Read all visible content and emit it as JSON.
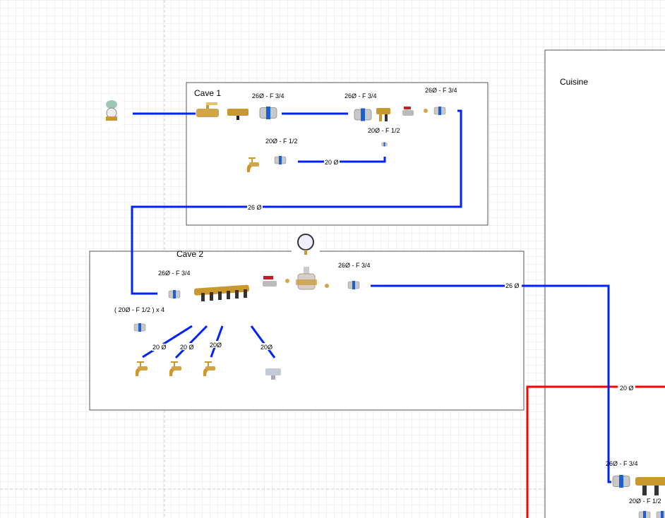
{
  "colors": {
    "cold_pipe": "#0022ff",
    "hot_pipe": "#ff0000",
    "brass": "#c9982f",
    "grid": "#e6e6e6"
  },
  "rooms": {
    "cave1": {
      "title": "Cave 1"
    },
    "cave2": {
      "title": "Cave 2"
    },
    "cuisine": {
      "title": "Cuisine"
    }
  },
  "labels": {
    "c1_a": "26Ø - F 3/4",
    "c1_b": "26Ø - F 3/4",
    "c1_c": "26Ø - F 3/4",
    "c1_d": "20Ø - F 1/2",
    "c1_e": "20Ø - F 1/2",
    "c1_pipe20": "20 Ø",
    "c1_pipe26": "26 Ø",
    "c2_a": "26Ø - F 3/4",
    "c2_b": "26Ø - F 3/4",
    "c2_x4": "( 20Ø - F 1/2 ) x 4",
    "c2_d1": "20 Ø",
    "c2_d2": "20 Ø",
    "c2_d3": "20Ø",
    "c2_d4": "20Ø",
    "c2_out": "26 Ø",
    "cu_hot": "20 Ø",
    "cu_a": "26Ø - F 3/4",
    "cu_b": "20Ø - F 1/2"
  },
  "icons": [
    "water-meter-icon",
    "ball-valve-icon",
    "tee-valve-icon",
    "pipe-fitting-icon",
    "manifold-icon",
    "tap-icon",
    "pressure-gauge-icon",
    "pressure-reducer-icon",
    "washing-machine-valve-icon"
  ]
}
